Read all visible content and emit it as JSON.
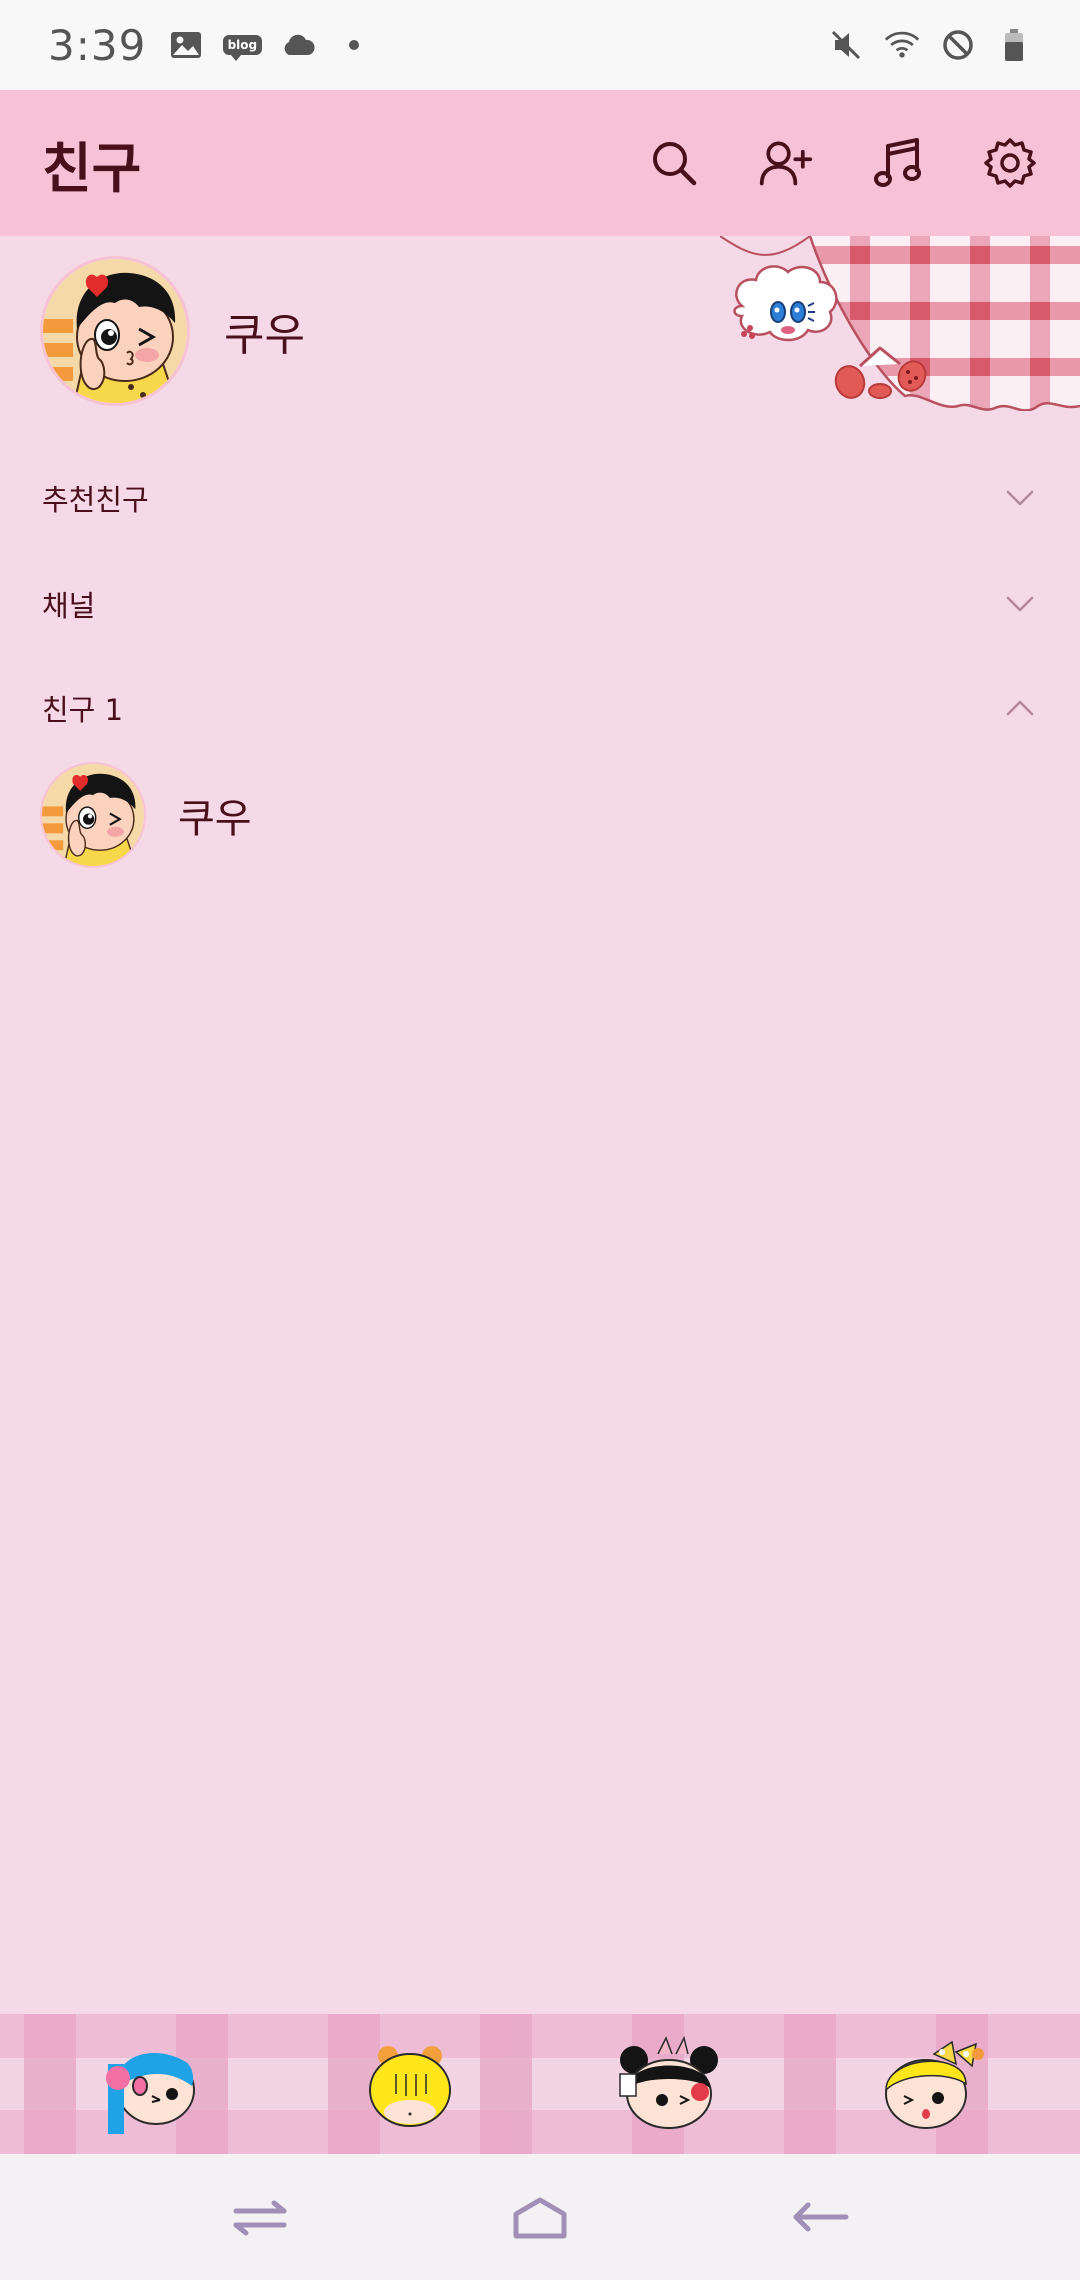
{
  "status_bar": {
    "time": "3:39",
    "blog_label": "blog",
    "left_icons": [
      "gallery-icon",
      "blog-icon",
      "cloud-icon",
      "notification-dot-icon"
    ],
    "right_icons": [
      "mute-icon",
      "wifi-icon",
      "do-not-disturb-icon",
      "battery-icon"
    ]
  },
  "header": {
    "title": "친구",
    "actions": [
      "search-icon",
      "add-friend-icon",
      "music-icon",
      "settings-icon"
    ]
  },
  "my_profile": {
    "name": "쿠우"
  },
  "sections": {
    "recommend": {
      "label": "추천친구",
      "state": "collapsed"
    },
    "channel": {
      "label": "채널",
      "state": "collapsed"
    },
    "friends": {
      "label": "친구 1",
      "state": "expanded"
    }
  },
  "friends": [
    {
      "name": "쿠우"
    }
  ],
  "bottom_tabs": [
    "tab-friends",
    "tab-chats",
    "tab-view",
    "tab-more"
  ],
  "nav_bar": [
    "recent-apps-icon",
    "home-icon",
    "back-icon"
  ],
  "colors": {
    "background": "#f5d9e6",
    "header": "#f7c2d6",
    "text": "#4a0f1c",
    "accent_check": "#e8a4c4"
  }
}
